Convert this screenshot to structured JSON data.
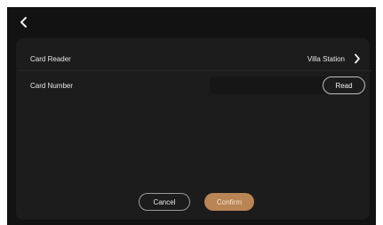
{
  "header": {
    "back_icon": "chevron-left-icon"
  },
  "card_reader": {
    "label": "Card Reader",
    "value": "Villa Station",
    "icon": "chevron-right-icon"
  },
  "card_number": {
    "label": "Card Number",
    "value": "",
    "read_label": "Read"
  },
  "footer": {
    "cancel_label": "Cancel",
    "confirm_label": "Confirm"
  },
  "colors": {
    "background": "#121212",
    "panel": "#1c1c1c",
    "accent": "#b98555"
  }
}
